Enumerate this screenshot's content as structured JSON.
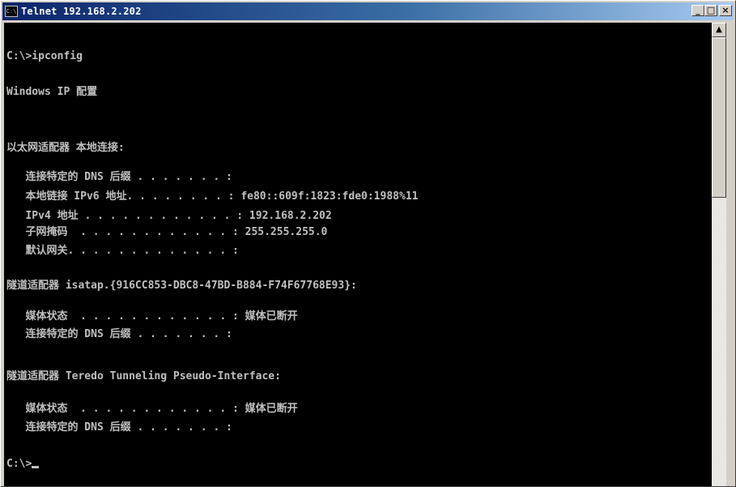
{
  "window": {
    "title": "Telnet 192.168.2.202",
    "icon_text": "C:\\",
    "minimize_label": "_",
    "maximize_label": "□",
    "close_label": "×"
  },
  "console": {
    "lines": [
      "",
      "C:\\>ipconfig",
      "",
      "Windows IP 配置",
      "",
      "",
      "以太网适配器 本地连接:",
      "",
      "   连接特定的 DNS 后缀 . . . . . . . :",
      "   本地链接 IPv6 地址. . . . . . . . : fe80::609f:1823:fde0:1988%11",
      "   IPv4 地址 . . . . . . . . . . . . : 192.168.2.202",
      "   子网掩码  . . . . . . . . . . . . : 255.255.255.0",
      "   默认网关. . . . . . . . . . . . . :",
      "",
      "隧道适配器 isatap.{916CC853-DBC8-47BD-B884-F74F67768E93}:",
      "",
      "   媒体状态  . . . . . . . . . . . . : 媒体已断开",
      "   连接特定的 DNS 后缀 . . . . . . . :",
      "",
      "隧道适配器 Teredo Tunneling Pseudo-Interface:",
      "",
      "   媒体状态  . . . . . . . . . . . . : 媒体已断开",
      "   连接特定的 DNS 后缀 . . . . . . . :",
      "",
      "C:\\>"
    ]
  },
  "scrollbar": {
    "up_arrow": "▲"
  },
  "colors": {
    "console_bg": "#000000",
    "console_text": "#c0c0c0",
    "titlebar_start": "#0a246a",
    "titlebar_end": "#a6caf0"
  },
  "icons": [
    "console-app-icon",
    "minimize-icon",
    "maximize-icon",
    "close-icon",
    "scroll-up-arrow-icon"
  ]
}
